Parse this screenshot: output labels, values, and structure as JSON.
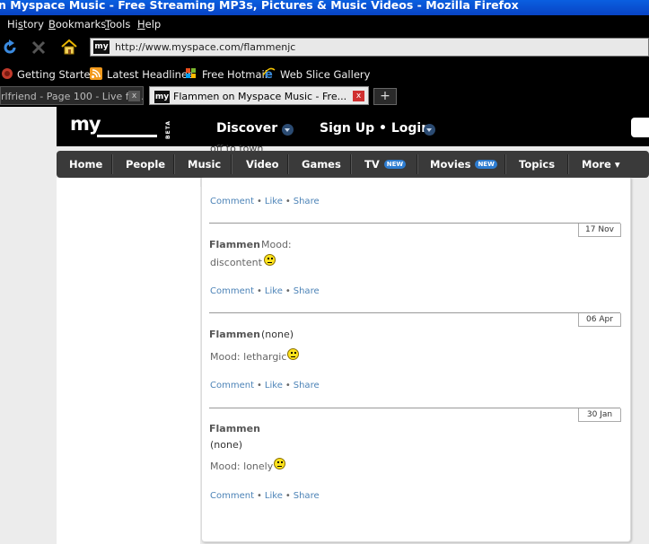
{
  "browser": {
    "title": "n Myspace Music - Free Streaming MP3s, Pictures & Music Videos - Mozilla Firefox",
    "menu": [
      {
        "label": "History",
        "key": "s"
      },
      {
        "label": "Bookmarks",
        "key": "B"
      },
      {
        "label": "Tools",
        "key": "T"
      },
      {
        "label": "Help",
        "key": "H"
      }
    ],
    "url": "http://www.myspace.com/flammenjc",
    "bookmarks": [
      "Getting Started",
      "Latest Headlines",
      "Free Hotmail",
      "Web Slice Gallery"
    ],
    "tabs": [
      {
        "label": "rlfriend - Page 100 - Live fo...",
        "close": "x",
        "active": false
      },
      {
        "label": "Flammen on Myspace Music - Fre...",
        "close": "x",
        "active": true
      }
    ],
    "new_tab": "+",
    "favicon_text": "my"
  },
  "site": {
    "logo": "my",
    "logo_beta": "BETA",
    "discover": "Discover",
    "signup": "Sign Up • Login",
    "nav": [
      {
        "label": "Home"
      },
      {
        "label": "People"
      },
      {
        "label": "Music"
      },
      {
        "label": "Video"
      },
      {
        "label": "Games"
      },
      {
        "label": "TV",
        "badge": "NEW"
      },
      {
        "label": "Movies",
        "badge": "NEW"
      },
      {
        "label": "Topics"
      },
      {
        "label": "More ▾"
      }
    ]
  },
  "feed": {
    "partial_text": "off to town",
    "actions": {
      "comment": "Comment",
      "like": "Like",
      "share": "Share",
      "sep": "•"
    },
    "entries": [
      {
        "date": "17 Nov",
        "author": "Flammen",
        "mood_label": "Mood:",
        "line2": "discontent"
      },
      {
        "date": "06 Apr",
        "author": "Flammen",
        "status": "(none)",
        "line2": "Mood: lethargic"
      },
      {
        "date": "30 Jan",
        "author": "Flammen",
        "status": "(none)",
        "line2": "Mood: lonely"
      }
    ]
  },
  "colors": {
    "link": "#4c83b7",
    "nav_bg": "#3a3a3a",
    "titlebar": "#0a5fe0"
  }
}
